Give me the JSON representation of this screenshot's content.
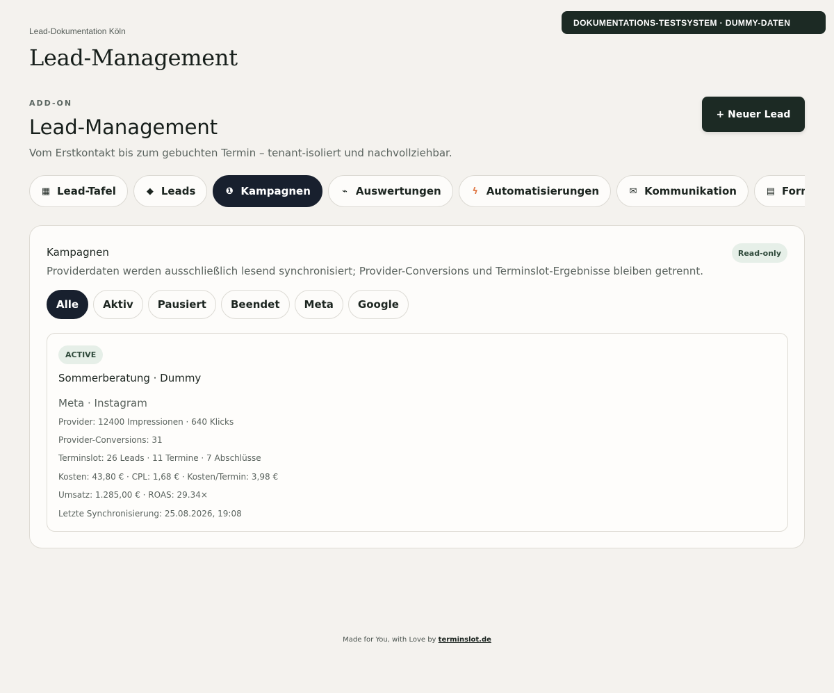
{
  "env_banner": "DOKUMENTATIONS-TESTSYSTEM · DUMMY-DATEN",
  "breadcrumb": "Lead-Dokumentation Köln",
  "page_title": "Lead-Management",
  "section": {
    "eyebrow": "ADD-ON",
    "title": "Lead-Management",
    "description": "Vom Erstkontakt bis zum gebuchten Termin – tenant-isoliert und nachvollziehbar.",
    "new_lead_label": "+ Neuer Lead"
  },
  "tabs": [
    {
      "label": "Lead-Tafel",
      "icon": "grid-icon",
      "glyph": "▦"
    },
    {
      "label": "Leads",
      "icon": "diamond-icon",
      "glyph": "◆"
    },
    {
      "label": "Kampagnen",
      "icon": "info-circle-icon",
      "glyph": "❶",
      "active": true
    },
    {
      "label": "Auswertungen",
      "icon": "trend-icon",
      "glyph": "⌁"
    },
    {
      "label": "Automatisierungen",
      "icon": "bolt-icon",
      "glyph": "ϟ"
    },
    {
      "label": "Kommunikation",
      "icon": "mail-icon",
      "glyph": "✉"
    },
    {
      "label": "Formulare",
      "icon": "form-icon",
      "glyph": "▤"
    },
    {
      "label": "",
      "icon": "command-icon",
      "glyph": "⌘"
    }
  ],
  "card": {
    "title": "Kampagnen",
    "description": "Providerdaten werden ausschließlich lesend synchronisiert; Provider-Conversions und Terminslot-Ergebnisse bleiben getrennt.",
    "badge": "Read-only",
    "filters": [
      "Alle",
      "Aktiv",
      "Pausiert",
      "Beendet",
      "Meta",
      "Google"
    ],
    "campaign": {
      "status": "ACTIVE",
      "name": "Sommerberatung · Dummy",
      "channel": "Meta · Instagram",
      "lines": [
        "Provider: 12400 Impressionen · 640 Klicks",
        "Provider-Conversions: 31",
        "Terminslot: 26 Leads · 11 Termine · 7 Abschlüsse",
        "Kosten: 43,80 € · CPL: 1,68 € · Kosten/Termin: 3,98 €",
        "Umsatz: 1.285,00 € · ROAS: 29.34×",
        "Letzte Synchronisierung: 25.08.2026, 19:08"
      ]
    }
  },
  "footer": {
    "text": "Made for You, with Love by",
    "link": "terminslot.de"
  }
}
